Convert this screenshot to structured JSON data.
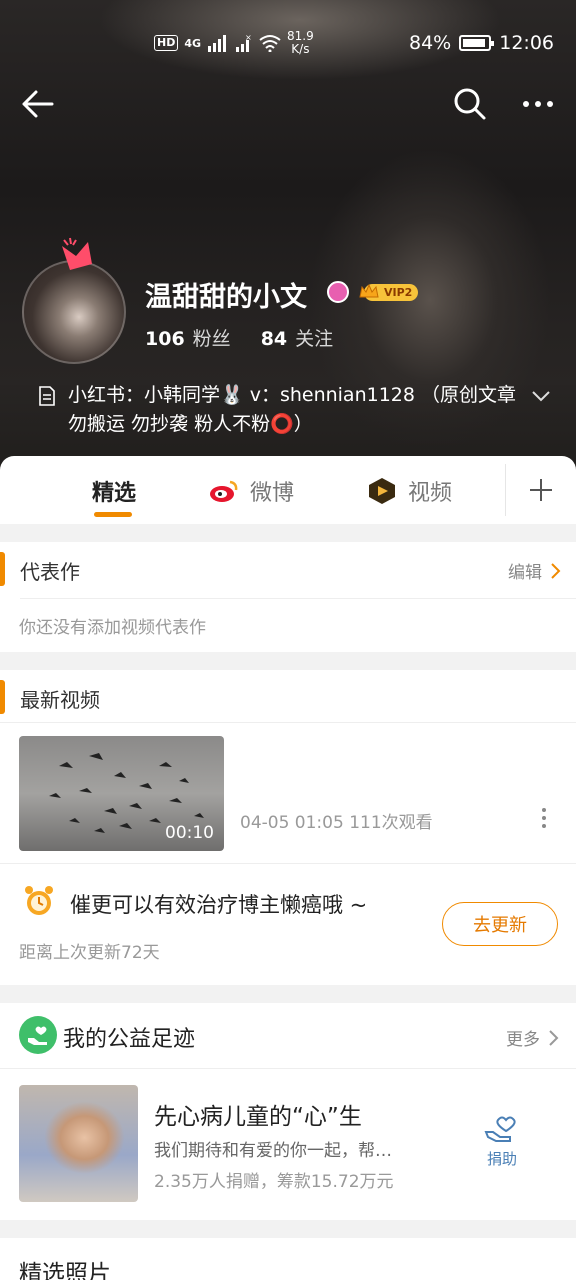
{
  "status_bar": {
    "hd": "HD",
    "net": "4G",
    "speed_top": "81.9",
    "speed_bottom": "K/s",
    "battery": "84%",
    "time": "12:06"
  },
  "profile": {
    "name": "温甜甜的小文",
    "vip_label": "VIP2",
    "followers_count": "106",
    "followers_label": "粉丝",
    "following_count": "84",
    "following_label": "关注",
    "bio": "小红书：小韩同学🐰 v：shennian1128 （原创文章 勿搬运 勿抄袭 粉人不粉⭕）"
  },
  "tabs": [
    {
      "label": "精选"
    },
    {
      "label": "微博"
    },
    {
      "label": "视频"
    }
  ],
  "representative": {
    "title": "代表作",
    "edit_label": "编辑",
    "empty_text": "你还没有添加视频代表作"
  },
  "latest_videos": {
    "title": "最新视频",
    "duration": "00:10",
    "meta": "04-05 01:05 111次观看"
  },
  "update_prompt": {
    "text": "催更可以有效治疗博主懒癌哦 ~",
    "sub": "距离上次更新72天",
    "button": "去更新"
  },
  "charity": {
    "title": "我的公益足迹",
    "more_label": "更多",
    "item_title": "先心病儿童的“心”生",
    "item_desc": "我们期待和有爱的你一起，帮…",
    "item_stats": "2.35万人捐赠，筹款15.72万元",
    "donate_label": "捐助"
  },
  "photos": {
    "title": "精选照片"
  },
  "colors": {
    "accent": "#f08a00",
    "charity_green": "#3fbf6a",
    "donate_blue": "#4a7fb5"
  }
}
